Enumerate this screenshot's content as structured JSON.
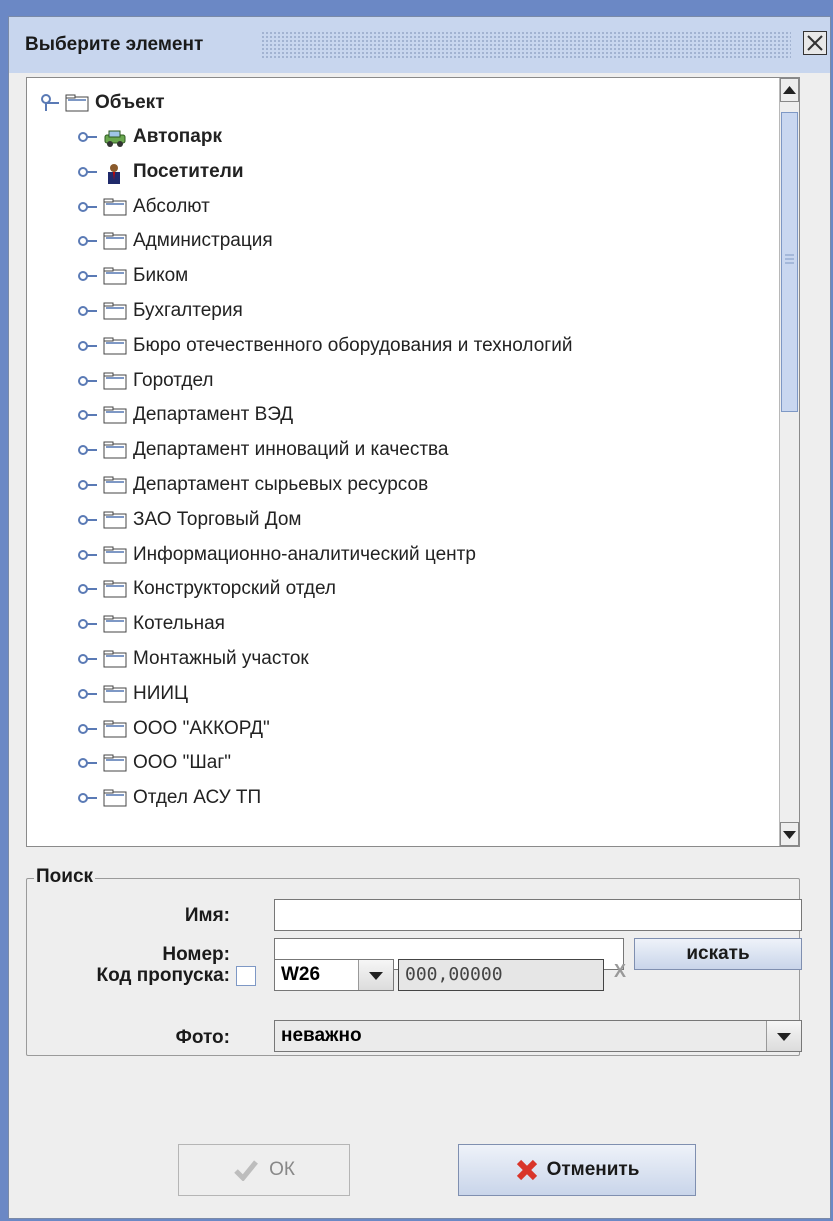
{
  "window": {
    "title": "Выберите элемент"
  },
  "tree": {
    "root": {
      "label": "Объект"
    },
    "items": [
      {
        "label": "Автопарк",
        "icon": "car-icon",
        "bold": true
      },
      {
        "label": "Посетители",
        "icon": "person-icon",
        "bold": true
      },
      {
        "label": "Абсолют",
        "icon": "folder-icon"
      },
      {
        "label": "Администрация",
        "icon": "folder-icon"
      },
      {
        "label": "Биком",
        "icon": "folder-icon"
      },
      {
        "label": "Бухгалтерия",
        "icon": "folder-icon"
      },
      {
        "label": "Бюро отечественного оборудования и технологий",
        "icon": "folder-icon"
      },
      {
        "label": "Горотдел",
        "icon": "folder-icon"
      },
      {
        "label": "Департамент ВЭД",
        "icon": "folder-icon"
      },
      {
        "label": "Департамент инноваций и качества",
        "icon": "folder-icon"
      },
      {
        "label": "Департамент сырьевых ресурсов",
        "icon": "folder-icon"
      },
      {
        "label": "ЗАО Торговый Дом",
        "icon": "folder-icon"
      },
      {
        "label": "Информационно-аналитический центр",
        "icon": "folder-icon"
      },
      {
        "label": "Конструкторский отдел",
        "icon": "folder-icon"
      },
      {
        "label": "Котельная",
        "icon": "folder-icon"
      },
      {
        "label": "Монтажный участок",
        "icon": "folder-icon"
      },
      {
        "label": "НИИЦ",
        "icon": "folder-icon"
      },
      {
        "label": "ООО \"АККОРД\"",
        "icon": "folder-icon"
      },
      {
        "label": "ООО \"Шаг\"",
        "icon": "folder-icon"
      },
      {
        "label": "Отдел АСУ ТП",
        "icon": "folder-icon"
      }
    ]
  },
  "search": {
    "title": "Поиск",
    "name_label": "Имя:",
    "name_value": "",
    "number_label": "Номер:",
    "number_value": "",
    "search_button": "искать",
    "pass_code_label": "Код пропуска:",
    "pass_code_prefix": "W26",
    "pass_code_value": "000,00000",
    "clear_mark": "X",
    "photo_label": "Фото:",
    "photo_value": "неважно"
  },
  "buttons": {
    "ok": "ОК",
    "cancel": "Отменить"
  },
  "colors": {
    "desktop": "#6b88c5",
    "titlebar": "#c8d6ee",
    "accent": "#7e98c5",
    "cancel_icon": "#d9352a"
  }
}
